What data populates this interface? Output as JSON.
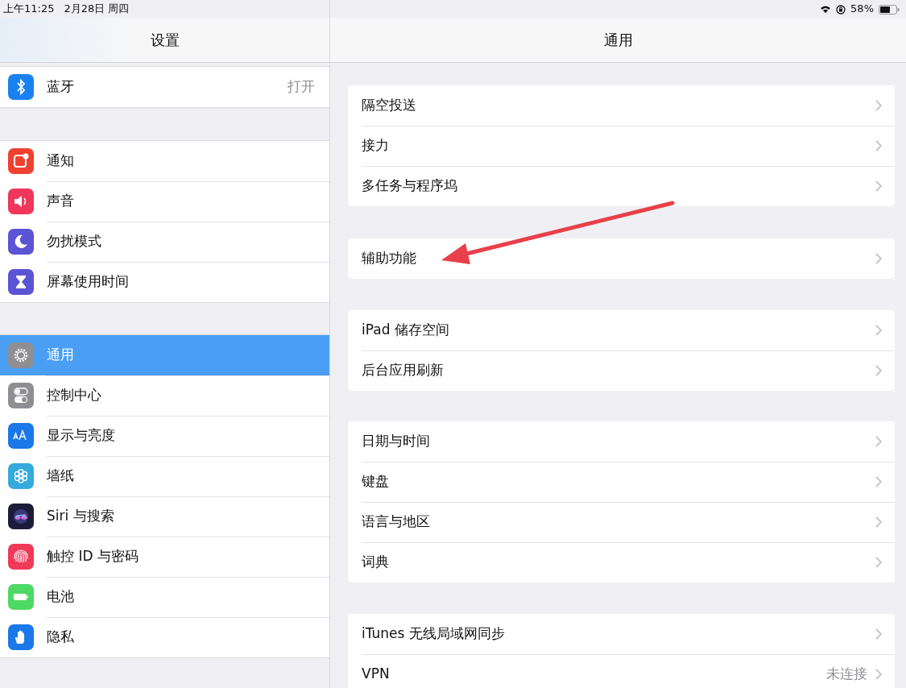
{
  "status_bar": {
    "time": "上午11:25",
    "date": "2月28日 周四",
    "battery": "58%"
  },
  "sidebar": {
    "title": "设置",
    "groups": [
      [
        {
          "label": "蓝牙",
          "value": "打开",
          "color": "#1a82f0",
          "selected": false
        }
      ],
      [
        {
          "label": "通知",
          "color": "#f04030",
          "selected": false
        },
        {
          "label": "声音",
          "color": "#f0365a",
          "selected": false
        },
        {
          "label": "勿扰模式",
          "color": "#5b54d4",
          "selected": false
        },
        {
          "label": "屏幕使用时间",
          "color": "#5b54d4",
          "selected": false
        }
      ],
      [
        {
          "label": "通用",
          "color": "#8e8e93",
          "selected": true
        },
        {
          "label": "控制中心",
          "color": "#8e8e93",
          "selected": false
        },
        {
          "label": "显示与亮度",
          "color": "#1a78e8",
          "selected": false
        },
        {
          "label": "墙纸",
          "color": "#35aadc",
          "selected": false
        },
        {
          "label": "Siri 与搜索",
          "color": "#1c1c3a",
          "selected": false
        },
        {
          "label": "触控 ID 与密码",
          "color": "#ee3a58",
          "selected": false
        },
        {
          "label": "电池",
          "color": "#4cd964",
          "selected": false
        },
        {
          "label": "隐私",
          "color": "#1a78e8",
          "selected": false
        }
      ]
    ]
  },
  "detail": {
    "title": "通用",
    "groups": [
      [
        {
          "label": "隔空投送"
        },
        {
          "label": "接力"
        },
        {
          "label": "多任务与程序坞"
        }
      ],
      [
        {
          "label": "辅助功能"
        }
      ],
      [
        {
          "label": "iPad 储存空间"
        },
        {
          "label": "后台应用刷新"
        }
      ],
      [
        {
          "label": "日期与时间"
        },
        {
          "label": "键盘"
        },
        {
          "label": "语言与地区"
        },
        {
          "label": "词典"
        }
      ],
      [
        {
          "label": "iTunes 无线局域网同步"
        },
        {
          "label": "VPN",
          "value": "未连接"
        }
      ]
    ]
  }
}
